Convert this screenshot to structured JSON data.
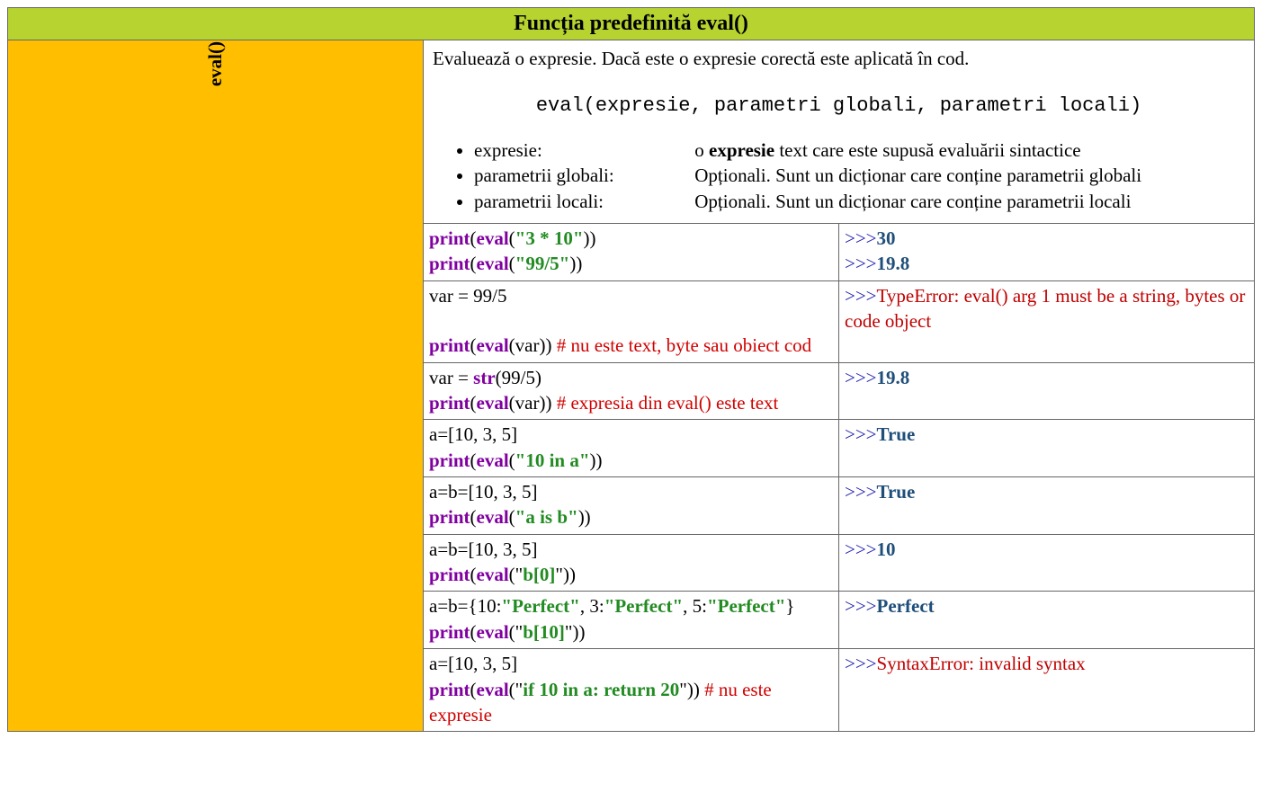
{
  "header": {
    "title": "Funcția predefinită eval()"
  },
  "side": {
    "label": "eval()"
  },
  "desc": {
    "intro": "Evaluează o expresie. Dacă este o expresie corectă este aplicată în cod.",
    "signature": "eval(expresie, parametri globali, parametri locali)",
    "params": [
      {
        "name": "expresie:",
        "pre": "o ",
        "bold": "expresie",
        "post": " text care este supusă evaluării sintactice"
      },
      {
        "name": "parametrii globali:",
        "pre": "Opționali. Sunt un dicționar care conține parametrii globali",
        "bold": "",
        "post": ""
      },
      {
        "name": "parametrii locali:",
        "pre": "Opționali. Sunt un dicționar care conține parametrii locali",
        "bold": "",
        "post": ""
      }
    ]
  },
  "rows": {
    "r1": {
      "code": {
        "l1": {
          "p1": "print",
          "p2": "(",
          "p3": "eval",
          "p4": "(",
          "p5": "\"3 * 10\"",
          "p6": "))"
        },
        "l2": {
          "p1": "print",
          "p2": "(",
          "p3": "eval",
          "p4": "(",
          "p5": "\"99/5\"",
          "p6": "))"
        }
      },
      "out": {
        "l1": {
          "prompt": ">>>",
          "val": "30"
        },
        "l2": {
          "prompt": ">>>",
          "val": "19.8"
        }
      }
    },
    "r2": {
      "code": {
        "l1": "var = 99/5",
        "blank": " ",
        "l2": {
          "p1": "print",
          "p2": "(",
          "p3": "eval",
          "p4": "(var))    ",
          "cm": "# nu este text, byte sau obiect cod"
        }
      },
      "out": {
        "prompt": ">>>",
        "err": "TypeError: eval() arg 1 must be a string, bytes or code object"
      }
    },
    "r3": {
      "code": {
        "l1": {
          "pre": "var = ",
          "fn": "str",
          "post": "(99/5)"
        },
        "l2": {
          "p1": "print",
          "p2": "(",
          "p3": "eval",
          "p4": "(var))    ",
          "cm": "# expresia din eval() este text"
        }
      },
      "out": {
        "prompt": ">>>",
        "val": "19.8"
      }
    },
    "r4": {
      "code": {
        "l1": "a=[10, 3, 5]",
        "l2": {
          "p1": "print",
          "p2": "(",
          "p3": "eval",
          "p4": "(",
          "p5": "\"10 in a\"",
          "p6": "))"
        }
      },
      "out": {
        "prompt": ">>>",
        "val": "True"
      }
    },
    "r5": {
      "code": {
        "l1": "a=b=[10, 3, 5]",
        "l2": {
          "p1": "print",
          "p2": "(",
          "p3": "eval",
          "p4": "(",
          "p5": "\"a is b\"",
          "p6": "))"
        }
      },
      "out": {
        "prompt": ">>>",
        "val": "True"
      }
    },
    "r6": {
      "code": {
        "l1": "a=b=[10, 3, 5]",
        "l2": {
          "p1": "print",
          "p2": "(",
          "p3": "eval",
          "p4": "(\"",
          "p5": "b[0]",
          "p6": "\"))"
        }
      },
      "out": {
        "prompt": ">>>",
        "val": "10"
      }
    },
    "r7": {
      "code": {
        "l1": {
          "pre": "a=b={10:",
          "s1": "\"Perfect\"",
          "m1": ", 3:",
          "s2": "\"Perfect\"",
          "m2": ", 5:",
          "s3": "\"Perfect\"",
          "post": "}"
        },
        "l2": {
          "p1": "print",
          "p2": "(",
          "p3": "eval",
          "p4": "(\"",
          "p5": "b[10]",
          "p6": "\"))"
        }
      },
      "out": {
        "prompt": ">>>",
        "val": "Perfect"
      }
    },
    "r8": {
      "code": {
        "l1": "a=[10, 3, 5]",
        "l2": {
          "p1": "print",
          "p2": "(",
          "p3": "eval",
          "p4": "(\"",
          "p5": "if 10 in a: return 20",
          "p6": "\"))   ",
          "cm": "# nu este expresie"
        }
      },
      "out": {
        "prompt": ">>>",
        "err": "SyntaxError: invalid syntax"
      }
    }
  }
}
